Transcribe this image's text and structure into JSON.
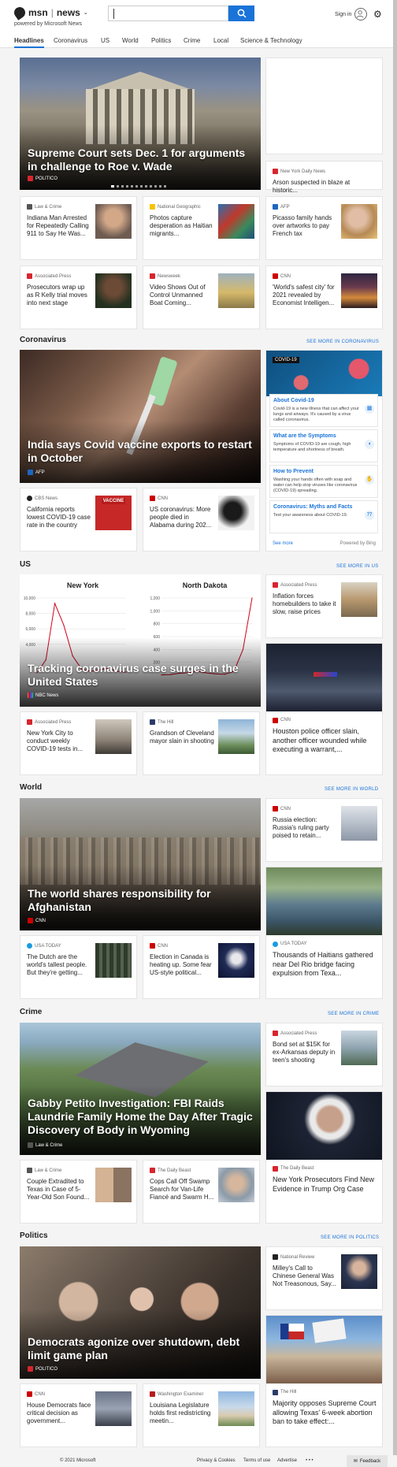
{
  "header": {
    "brand": "msn",
    "product": "news",
    "powered_by": "powered by Microsoft News",
    "sign_in": "Sign in"
  },
  "nav": [
    "Headlines",
    "Coronavirus",
    "US",
    "World",
    "Politics",
    "Crime",
    "Local",
    "Science & Technology"
  ],
  "top": {
    "hero": {
      "title": "Supreme Court sets Dec. 1 for arguments in challenge to Roe v. Wade",
      "source": "POLITICO"
    },
    "side": {
      "source": "New York Daily News",
      "title": "Arson suspected in blaze at historic..."
    },
    "minis": [
      {
        "source": "Law & Crime",
        "title": "Indiana Man Arrested for Repeatedly Calling 911 to Say He Was..."
      },
      {
        "source": "National Geographic",
        "title": "Photos capture desperation as Haitian migrants..."
      },
      {
        "source": "AFP",
        "title": "Picasso family hands over artworks to pay French tax"
      },
      {
        "source": "Associated Press",
        "title": "Prosecutors wrap up as R Kelly trial moves into next stage"
      },
      {
        "source": "Newsweek",
        "title": "Video Shows Out of Control Unmanned Boat Coming..."
      },
      {
        "source": "CNN",
        "title": "'World's safest city' for 2021 revealed by Economist Intelligen..."
      }
    ]
  },
  "coronavirus": {
    "heading": "Coronavirus",
    "see_more": "SEE MORE IN CORONAVIRUS",
    "hero": {
      "title": "India says Covid vaccine exports to restart in October",
      "source": "AFP"
    },
    "minis": [
      {
        "source": "CBS News",
        "title": "California reports lowest COVID-19 case rate in the country"
      },
      {
        "source": "CNN",
        "title": "US coronavirus: More people died in Alabama during 202..."
      }
    ],
    "panel": {
      "badge": "COVID-19",
      "items": [
        {
          "title": "About Covid-19",
          "text": "Covid-19 is a new illness that can affect your lungs and airways. It's caused by a virus called coronavirus."
        },
        {
          "title": "What are the Symptoms",
          "text": "Symptoms of COVID-19 are cough, high temperature and shortness of breath."
        },
        {
          "title": "How to Prevent",
          "text": "Washing your hands often with soap and water can help stop viruses like coronavirus (COVID-19) spreading."
        },
        {
          "title": "Coronavirus: Myths and Facts",
          "text": "Test your awareness about COVID-19."
        }
      ],
      "see_more": "See more",
      "powered": "Powered by Bing"
    }
  },
  "us": {
    "heading": "US",
    "see_more": "SEE MORE IN US",
    "hero": {
      "title": "Tracking coronavirus case surges in the United States",
      "source": "NBC News"
    },
    "chart_labels": {
      "left": "New York",
      "right": "North Dakota"
    },
    "side": {
      "source": "Associated Press",
      "title": "Inflation forces homebuilders to take it slow, raise prices"
    },
    "side2": {
      "source": "CNN",
      "title": "Houston police officer slain, another officer wounded while executing a warrant,..."
    },
    "minis": [
      {
        "source": "Associated Press",
        "title": "New York City to conduct weekly COVID-19 tests in..."
      },
      {
        "source": "The Hill",
        "title": "Grandson of Cleveland mayor slain in shooting"
      }
    ]
  },
  "chart_data": [
    {
      "type": "line",
      "title": "New York",
      "ylim": [
        0,
        10000
      ],
      "yticks": [
        "10,000",
        "8,000",
        "6,000",
        "4,000"
      ],
      "x": [
        0,
        1,
        2,
        3,
        4,
        5,
        6,
        7,
        8,
        9,
        10
      ],
      "values": [
        300,
        2000,
        9300,
        6500,
        2500,
        800,
        500,
        700,
        900,
        500,
        400
      ]
    },
    {
      "type": "line",
      "title": "North Dakota",
      "ylim": [
        0,
        1200
      ],
      "yticks": [
        "1,200",
        "1,000",
        "800",
        "600",
        "400",
        "200"
      ],
      "x": [
        0,
        1,
        2,
        3,
        4,
        5,
        6,
        7,
        8,
        9,
        10
      ],
      "values": [
        5,
        10,
        30,
        40,
        60,
        35,
        20,
        15,
        60,
        400,
        1200
      ]
    }
  ],
  "world": {
    "heading": "World",
    "see_more": "SEE MORE IN WORLD",
    "hero": {
      "title": "The world shares responsibility for Afghanistan",
      "source": "CNN"
    },
    "side": {
      "source": "CNN",
      "title": "Russia election: Russia's ruling party poised to retain..."
    },
    "side2": {
      "source": "USA TODAY",
      "title": "Thousands of Haitians gathered near Del Rio bridge facing expulsion from Texa..."
    },
    "minis": [
      {
        "source": "USA TODAY",
        "title": "The Dutch are the world's tallest people. But they're getting..."
      },
      {
        "source": "CNN",
        "title": "Election in Canada is heating up. Some fear US-style political..."
      }
    ]
  },
  "crime": {
    "heading": "Crime",
    "see_more": "SEE MORE IN CRIME",
    "hero": {
      "title": "Gabby Petito Investigation: FBI Raids Laundrie Family Home the Day After Tragic Discovery of Body in Wyoming",
      "source": "Law & Crime"
    },
    "side": {
      "source": "Associated Press",
      "title": "Bond set at $15K for ex-Arkansas deputy in teen's shooting"
    },
    "side2": {
      "source": "The Daily Beast",
      "title": "New York Prosecutors Find New Evidence in Trump Org Case"
    },
    "minis": [
      {
        "source": "Law & Crime",
        "title": "Couple Extradited to Texas in Case of 5-Year-Old Son Found..."
      },
      {
        "source": "The Daily Beast",
        "title": "Cops Call Off Swamp Search for Van-Life Fiancé and Swarm H..."
      }
    ]
  },
  "politics": {
    "heading": "Politics",
    "see_more": "SEE MORE IN POLITICS",
    "hero": {
      "title": "Democrats agonize over shutdown, debt limit game plan",
      "source": "POLITICO"
    },
    "side": {
      "source": "National Review",
      "title": "Milley's Call to Chinese General Was Not Treasonous, Say..."
    },
    "side2": {
      "source": "The Hill",
      "title": "Majority opposes Supreme Court allowing Texas' 6-week abortion ban to take effect:..."
    },
    "minis": [
      {
        "source": "CNN",
        "title": "House Democrats face critical decision as government..."
      },
      {
        "source": "Washington Examiner",
        "title": "Louisiana Legislature holds first redistricting meetin..."
      }
    ]
  },
  "footer": {
    "copyright": "© 2021 Microsoft",
    "links": [
      "Privacy & Cookies",
      "Terms of use",
      "Advertise"
    ],
    "more": "• • •",
    "feedback": "Feedback"
  }
}
